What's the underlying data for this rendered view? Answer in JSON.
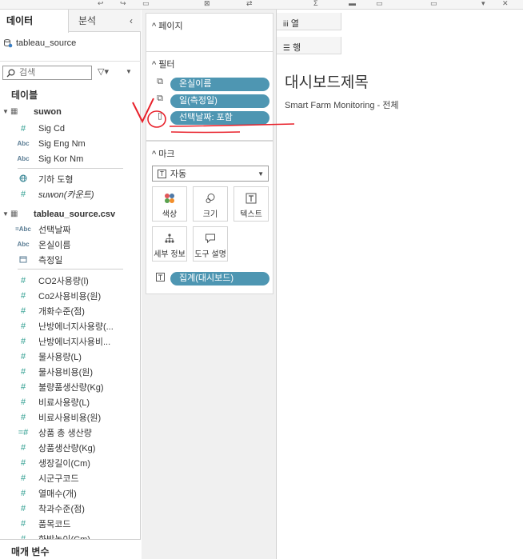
{
  "left_pane": {
    "tabs": [
      {
        "label": "데이터"
      },
      {
        "label": "분석"
      }
    ],
    "data_source": "tableau_source",
    "search": {
      "placeholder": "검색"
    },
    "section_title": "테이블",
    "tables": [
      {
        "name": "suwon",
        "fields": [
          {
            "label": "Sig Cd",
            "type": "measure"
          },
          {
            "label": "Sig Eng Nm",
            "type": "text"
          },
          {
            "label": "Sig Kor Nm",
            "type": "text"
          },
          {
            "label": "기하 도형",
            "type": "geo"
          },
          {
            "label": "suwon(카운트)",
            "type": "measure"
          }
        ]
      },
      {
        "name": "tableau_source.csv",
        "fields": [
          {
            "label": "선택날짜",
            "type": "calc-text"
          },
          {
            "label": "온실이름",
            "type": "text"
          },
          {
            "label": "측정일",
            "type": "date"
          },
          {
            "label": "CO2사용량(l)",
            "type": "measure"
          },
          {
            "label": "Co2사용비용(원)",
            "type": "measure"
          },
          {
            "label": "개화수준(점)",
            "type": "measure"
          },
          {
            "label": "난방에너지사용량(...",
            "type": "measure"
          },
          {
            "label": "난방에너지사용비...",
            "type": "measure"
          },
          {
            "label": "물사용량(L)",
            "type": "measure"
          },
          {
            "label": "물사용비용(원)",
            "type": "measure"
          },
          {
            "label": "불량품생산량(Kg)",
            "type": "measure"
          },
          {
            "label": "비료사용량(L)",
            "type": "measure"
          },
          {
            "label": "비료사용비용(원)",
            "type": "measure"
          },
          {
            "label": "상품 총 생산량",
            "type": "calc-measure"
          },
          {
            "label": "상품생산량(Kg)",
            "type": "measure"
          },
          {
            "label": "생장길이(Cm)",
            "type": "measure"
          },
          {
            "label": "시군구코드",
            "type": "measure"
          },
          {
            "label": "열매수(개)",
            "type": "measure"
          },
          {
            "label": "착과수준(점)",
            "type": "measure"
          },
          {
            "label": "품목코드",
            "type": "measure"
          },
          {
            "label": "화방높이(Cm)",
            "type": "measure"
          }
        ]
      }
    ],
    "parameters_title": "매개 변수"
  },
  "shelves": {
    "pages": "페이지",
    "filters": {
      "title": "필터",
      "pills": [
        {
          "label": "온실이름"
        },
        {
          "label": "일(측정일)"
        },
        {
          "label": "선택날짜: 포함"
        }
      ]
    },
    "marks": {
      "title": "마크",
      "mark_type": "자동",
      "buttons": [
        {
          "label": "색상",
          "icon": "color-dots-icon"
        },
        {
          "label": "크기",
          "icon": "size-icon"
        },
        {
          "label": "텍스트",
          "icon": "text-t-icon"
        },
        {
          "label": "세부 정보",
          "icon": "detail-icon"
        },
        {
          "label": "도구 설명",
          "icon": "tooltip-icon"
        }
      ],
      "text_pill": "집계(대시보드)"
    }
  },
  "canvas": {
    "columns_label": "열",
    "rows_label": "행",
    "title": "대시보드제목",
    "subtitle": "Smart Farm Monitoring - 전체"
  },
  "colors": {
    "pill": "#4e96b2",
    "measure_icon": "#2d9d8f",
    "annotation": "#e8202a"
  }
}
